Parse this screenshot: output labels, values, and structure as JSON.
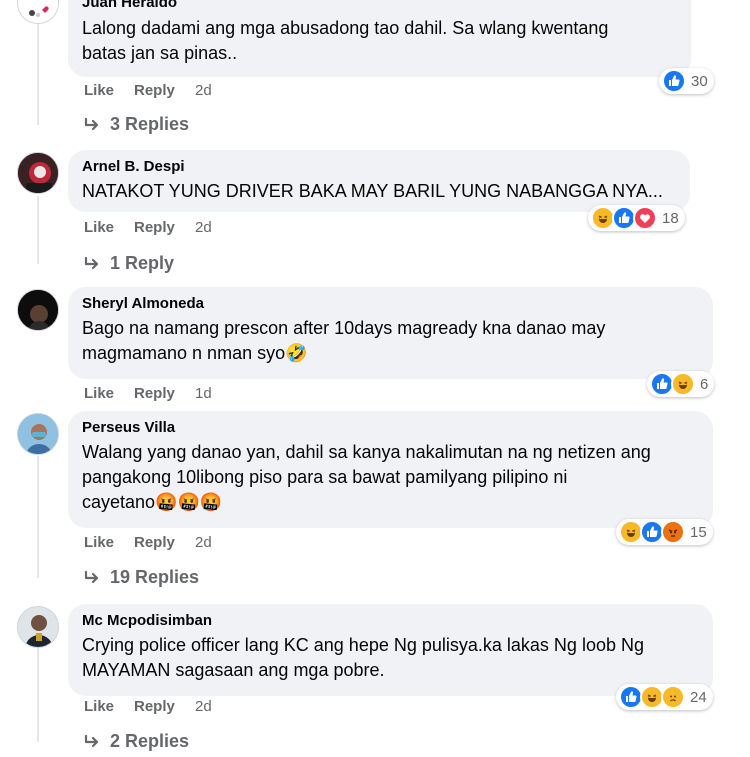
{
  "comments": [
    {
      "author": "Juan Heraldo",
      "text_line1": "Lalong dadami ang mga abusadong tao dahil. Sa wlang kwentang",
      "text_line2": "batas jan sa pinas..",
      "like_label": "Like",
      "reply_label": "Reply",
      "time": "2d",
      "reaction_count": "30",
      "reactions": [
        "like-icon"
      ],
      "replies": "3 Replies"
    },
    {
      "author": "Arnel B. Despi",
      "text_line1": "NATAKOT YUNG DRIVER BAKA MAY BARIL YUNG NABANGGA NYA...",
      "like_label": "Like",
      "reply_label": "Reply",
      "time": "2d",
      "reaction_count": "18",
      "reactions": [
        "haha-icon",
        "like-icon",
        "love-icon"
      ],
      "replies": "1 Reply"
    },
    {
      "author": "Sheryl Almoneda",
      "text_line1": "Bago na namang prescon after 10days magready kna danao may",
      "text_line2": "magmamano n nman syo🤣",
      "like_label": "Like",
      "reply_label": "Reply",
      "time": "1d",
      "reaction_count": "6",
      "reactions": [
        "like-icon",
        "haha-icon"
      ]
    },
    {
      "author": "Perseus Villa",
      "text_line1": "Walang yang danao yan, dahil sa kanya nakalimutan na ng netizen ang",
      "text_line2": "pangakong 10libong piso para sa bawat pamilyang pilipino ni",
      "text_line3": "cayetano🤬🤬🤬",
      "like_label": "Like",
      "reply_label": "Reply",
      "time": "2d",
      "reaction_count": "15",
      "reactions": [
        "haha-icon",
        "like-icon",
        "angry-icon"
      ],
      "replies": "19 Replies"
    },
    {
      "author": "Mc Mcpodisimban",
      "text_line1": "Crying police officer lang KC ang hepe Ng pulisya.ka lakas Ng loob Ng",
      "text_line2": "MAYAMAN sagasaan ang mga pobre.",
      "like_label": "Like",
      "reply_label": "Reply",
      "time": "2d",
      "reaction_count": "24",
      "reactions": [
        "like-icon",
        "haha-icon",
        "sad-icon"
      ],
      "replies": "2 Replies"
    }
  ],
  "colors": {
    "bubble_bg": "#f0f2f5",
    "meta_text": "#65676b",
    "like_blue": "#1877f2",
    "love_red": "#f33e58",
    "haha_yellow": "#f7b928",
    "angry_orange": "#e9710f"
  }
}
